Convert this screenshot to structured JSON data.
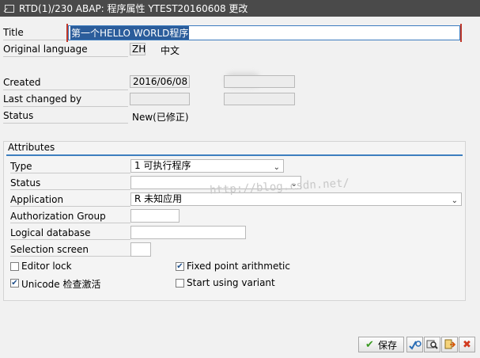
{
  "window": {
    "title": "RTD(1)/230 ABAP: 程序属性 YTEST20160608 更改"
  },
  "header": {
    "title_label": "Title",
    "title_value": "第一个HELLO WORLD程序",
    "original_language_label": "Original language",
    "original_language_code": "ZH",
    "original_language_name": "中文",
    "created_label": "Created",
    "created_date": "2016/06/08",
    "last_changed_label": "Last changed by",
    "status_label": "Status",
    "status_value": "New(已修正)"
  },
  "attributes": {
    "group_title": "Attributes",
    "type_label": "Type",
    "type_value": "1 可执行程序",
    "status_label": "Status",
    "status_value": "",
    "application_label": "Application",
    "application_value": "R 未知应用",
    "auth_group_label": "Authorization Group",
    "logical_db_label": "Logical database",
    "selection_screen_label": "Selection screen",
    "editor_lock_label": "Editor lock",
    "editor_lock_checked": false,
    "fixed_point_label": "Fixed point arithmetic",
    "fixed_point_checked": true,
    "unicode_label": "Unicode 检查激活",
    "unicode_checked": true,
    "variant_label": "Start using variant",
    "variant_checked": false
  },
  "watermark": "http://blog.csdn.net/",
  "toolbar": {
    "save_label": "保存",
    "check_mark": "✔",
    "cancel_mark": "✖",
    "accent": "#3b9a22",
    "danger": "#d23a1e"
  }
}
